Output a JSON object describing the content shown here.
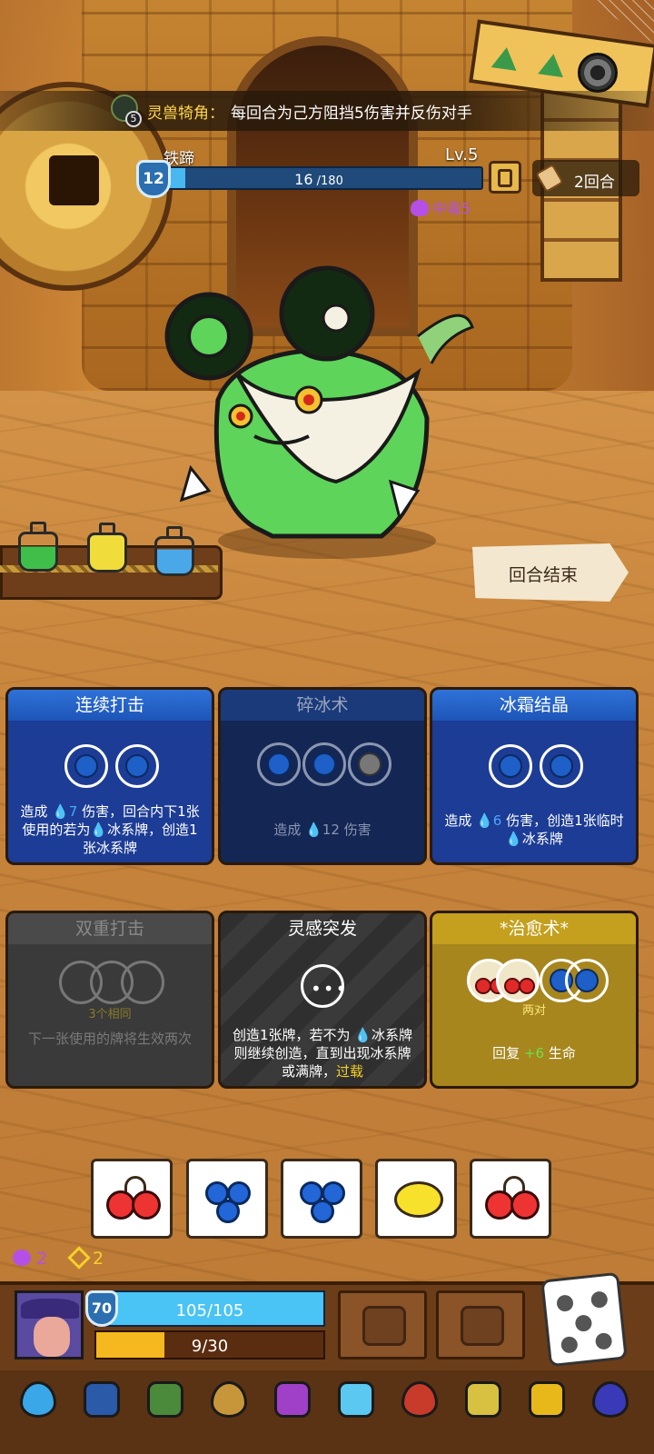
{
  "banner": {
    "level": "5",
    "name": "灵兽犄角：",
    "description": "每回合为己方阻挡5伤害并反伤对手"
  },
  "enemy": {
    "name": "铁蹄",
    "level": "Lv.5",
    "shield": "12",
    "hp_current": "16",
    "hp_max": " /180",
    "hp_fraction": 0.089,
    "status": "中毒5"
  },
  "turn": {
    "label": "2回合"
  },
  "end_turn": {
    "label": "回合结束"
  },
  "cards": [
    {
      "title": "连续打击",
      "text_a": "造成 ",
      "text_b": "7",
      "text_c": " 伤害，回合内下1张使用的若为",
      "text_d": "冰系牌，创造1张冰系牌"
    },
    {
      "title": "碎冰术",
      "text_a": "造成 ",
      "text_b": "12",
      "text_c": " 伤害"
    },
    {
      "title": "冰霜结晶",
      "text_a": "造成 ",
      "text_b": "6",
      "text_c": " 伤害，创造1张临时",
      "text_d": "冰系牌"
    },
    {
      "title": "双重打击",
      "hint": "3个相同",
      "text": "下一张使用的牌将生效两次"
    },
    {
      "title": "灵感突发",
      "text_a": "创造1张牌，若不为 ",
      "text_b": "冰系牌则继续创造，直到出现冰系牌或满牌，",
      "text_c": "过载"
    },
    {
      "title": "*治愈术*",
      "hint": "两对",
      "text_a": "回复 ",
      "text_b": "6",
      "text_c": " 生命"
    }
  ],
  "dice": [
    {
      "face": "cherry"
    },
    {
      "face": "blueberry"
    },
    {
      "face": "blueberry"
    },
    {
      "face": "lemon"
    },
    {
      "face": "cherry"
    }
  ],
  "player": {
    "poison": "2",
    "energy": "2",
    "shield": "70",
    "hp": "105/105",
    "hp_fraction": 1.0,
    "xp": "9/30",
    "xp_fraction": 0.3
  },
  "toolbar": [
    {
      "icon": "water-drop-icon",
      "color": "#3aa8e8"
    },
    {
      "icon": "ice-sack-icon",
      "color": "#2a5aa8"
    },
    {
      "icon": "moss-card-icon",
      "color": "#4a8a3a"
    },
    {
      "icon": "scroll-bag-icon",
      "color": "#c8963a"
    },
    {
      "icon": "eye-potion-icon",
      "color": "#a040c8"
    },
    {
      "icon": "ice-gem-icon",
      "color": "#5ac8f0"
    },
    {
      "icon": "bracelet-icon",
      "color": "#c83a2a"
    },
    {
      "icon": "compass-helm-icon",
      "color": "#d8c040"
    },
    {
      "icon": "gold-helm-icon",
      "color": "#e8b81a"
    },
    {
      "icon": "triangle-gem-icon",
      "color": "#3a3ab8"
    }
  ]
}
